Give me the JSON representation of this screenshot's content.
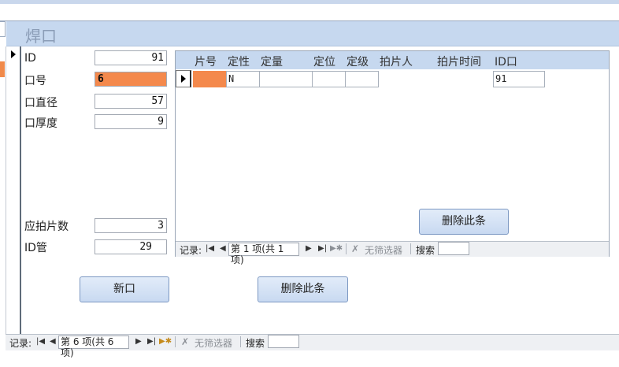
{
  "form": {
    "title": "焊口",
    "fields": [
      {
        "label": "ID",
        "value": "91"
      },
      {
        "label": "口号",
        "value": "6"
      },
      {
        "label": "口直径",
        "value": "57"
      },
      {
        "label": "口厚度",
        "value": "9"
      },
      {
        "label": "应拍片数",
        "value": "3"
      },
      {
        "label": "ID管",
        "value": "29"
      }
    ],
    "buttons": {
      "new_joint": "新口",
      "delete": "删除此条"
    }
  },
  "subform": {
    "columns": [
      "片号",
      "定性",
      "定量",
      "定位",
      "定级",
      "拍片人",
      "拍片时间",
      "ID口"
    ],
    "row": {
      "pianhao": "",
      "dingxing": "N",
      "dingliang": "",
      "dingwei": "",
      "dingji": "",
      "paipianren": "",
      "paipianshijian": "",
      "idkou": "91"
    },
    "delete_button": "删除此条",
    "nav": {
      "record_label": "记录:",
      "position": "第 1 项(共 1 项)",
      "no_filter": "无筛选器",
      "search": "搜索"
    }
  },
  "main_nav": {
    "record_label": "记录:",
    "position": "第 6 项(共 6 项)",
    "no_filter": "无筛选器",
    "search": "搜索"
  },
  "colors": {
    "header_bg": "#c6d8ef",
    "highlight_field": "#f4894c",
    "button_bg": "#d3e1f4"
  }
}
